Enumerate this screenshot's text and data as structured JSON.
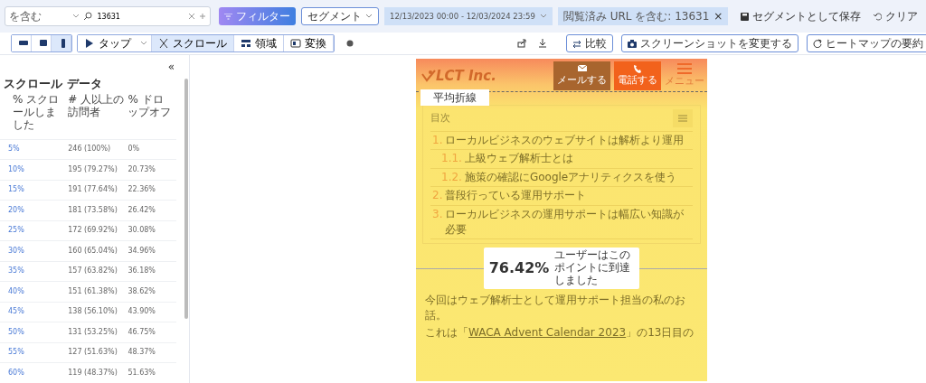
{
  "filter_bar": {
    "operator": "を含む",
    "search": {
      "value": "13631"
    },
    "filter_button": "フィルター",
    "segment_button": "セグメント",
    "date_range": "12/13/2023 00:00 - 12/03/2024 23:59",
    "chips": [
      {
        "label": "閲覧済み URL を含む: 13631",
        "remove": "×"
      }
    ],
    "save_segment": "セグメントとして保存",
    "clear": "クリア"
  },
  "toolbar": {
    "devices": [
      {
        "kind": "desktop",
        "selected": false
      },
      {
        "kind": "tablet",
        "selected": false
      },
      {
        "kind": "mobile",
        "selected": true
      }
    ],
    "modes": [
      {
        "kind": "tap",
        "label": "タップ",
        "selected": false
      },
      {
        "kind": "scroll",
        "label": "スクロール",
        "selected": true
      },
      {
        "kind": "area",
        "label": "領域",
        "selected": false
      },
      {
        "kind": "conversion",
        "label": "変換",
        "selected": false
      }
    ],
    "compare": "比較",
    "change_screenshot": "スクリーンショットを変更する",
    "summary": "ヒートマップの要約"
  },
  "scroll_panel": {
    "collapse": "«",
    "title": "スクロール データ",
    "columns": [
      "% スクロールしました",
      "# 人以上の訪問者",
      "% ドロップオフ"
    ],
    "rows": [
      [
        "5%",
        "246 (100%)",
        "0%"
      ],
      [
        "10%",
        "195 (79.27%)",
        "20.73%"
      ],
      [
        "15%",
        "191 (77.64%)",
        "22.36%"
      ],
      [
        "20%",
        "181 (73.58%)",
        "26.42%"
      ],
      [
        "25%",
        "172 (69.92%)",
        "30.08%"
      ],
      [
        "30%",
        "160 (65.04%)",
        "34.96%"
      ],
      [
        "35%",
        "157 (63.82%)",
        "36.18%"
      ],
      [
        "40%",
        "151 (61.38%)",
        "38.62%"
      ],
      [
        "45%",
        "138 (56.10%)",
        "43.90%"
      ],
      [
        "50%",
        "131 (53.25%)",
        "46.75%"
      ],
      [
        "55%",
        "127 (51.63%)",
        "48.37%"
      ],
      [
        "60%",
        "119 (48.37%)",
        "51.63%"
      ]
    ]
  },
  "heatmap": {
    "logo": "LCT Inc.",
    "header_buttons": [
      {
        "kind": "mail",
        "label": "メールする"
      },
      {
        "kind": "phone",
        "label": "電話する"
      }
    ],
    "menu_label": "メニュー",
    "fold_label": "平均折線",
    "toc": {
      "title": "目次",
      "items": [
        {
          "number": "1.",
          "text": "ローカルビジネスのウェブサイトは解析より運用",
          "children": [
            {
              "number": "1.1.",
              "text": "上級ウェブ解析士とは"
            },
            {
              "number": "1.2.",
              "text": "施策の確認にGoogleアナリティクスを使う"
            }
          ]
        },
        {
          "number": "2.",
          "text": "普段行っている運用サポート"
        },
        {
          "number": "3.",
          "text": "ローカルビジネスの運用サポートは幅広い知識が必要"
        }
      ]
    },
    "paragraphs": [
      "今回はウェブ解析士として運用サポート担当の私のお話。"
    ],
    "link_sentence": {
      "before": "これは「",
      "link": "WACA Advent Calendar 2023",
      "after": "」の13日目の"
    },
    "tooltip": {
      "value": "76.42%",
      "caption": "ユーザーはこのポイントに到達しました"
    }
  }
}
